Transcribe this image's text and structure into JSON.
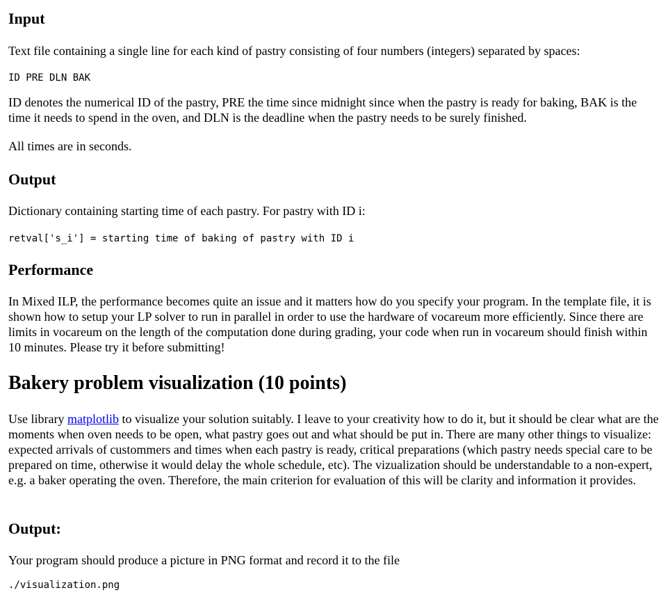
{
  "input_section": {
    "heading": "Input",
    "intro": "Text file containing a single line for each kind of pastry consisting of four numbers (integers) separated by spaces:",
    "format": "ID PRE DLN BAK",
    "description": "ID denotes the numerical ID of the pastry, PRE the time since midnight since when the pastry is ready for baking, BAK is the time it needs to spend in the oven, and DLN is the deadline when the pastry needs to be surely finished.",
    "units_note": "All times are in seconds."
  },
  "output_section": {
    "heading": "Output",
    "intro": "Dictionary containing starting time of each pastry. For pastry with ID i:",
    "code": "retval['s_i'] = starting time of baking of pastry with ID i"
  },
  "performance_section": {
    "heading": "Performance",
    "text": "In Mixed ILP, the performance becomes quite an issue and it matters how do you specify your program. In the template file, it is shown how to setup your LP solver to run in parallel in order to use the hardware of vocareum more efficiently. Since there are limits in vocareum on the length of the computation done during grading, your code when run in vocareum should finish within 10 minutes. Please try it before submitting!"
  },
  "visualization_section": {
    "heading": "Bakery problem visualization (10 points)",
    "text_before_link": "Use library ",
    "link_text": "matplotlib",
    "text_after_link": " to visualize your solution suitably. I leave to your creativity how to do it, but it should be clear what are the moments when oven needs to be open, what pastry goes out and what should be put in. There are many other things to visualize: expected arrivals of custommers and times when each pastry is ready, critical preparations (which pastry needs special care to be prepared on time, otherwise it would delay the whole schedule, etc). The vizualization should be understandable to a non-expert, e.g. a baker operating the oven. Therefore, the main criterion for evaluation of this will be clarity and information it provides."
  },
  "viz_output_section": {
    "heading": "Output:",
    "intro": "Your program should produce a picture in PNG format and record it to the file",
    "path": "./visualization.png"
  },
  "colors": {
    "text": "#000000",
    "link": "#0000ee",
    "background": "#ffffff"
  }
}
